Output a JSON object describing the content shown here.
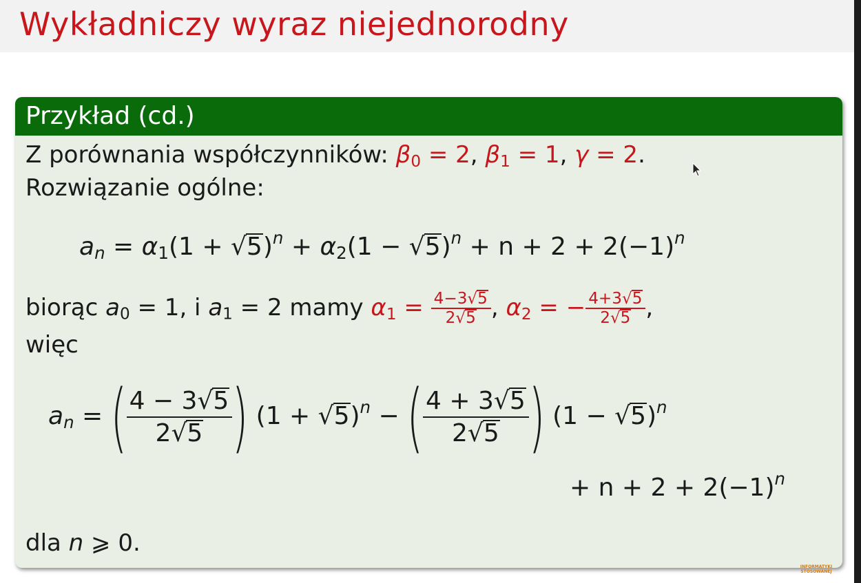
{
  "slide": {
    "title": "Wykładniczy wyraz niejednorodny"
  },
  "block": {
    "title": "Przykład (cd.)",
    "line1_text": "Z porównania współczynników:",
    "beta0": "β",
    "beta0_sub": "0",
    "beta0_val": " = 2",
    "beta1": "β",
    "beta1_sub": "1",
    "beta1_val": " = 1",
    "gamma": "γ",
    "gamma_val": " = 2",
    "line2_text": "Rozwiązanie ogólne:",
    "eq1": {
      "lhs": "a",
      "lhs_sub": "n",
      "alpha1": "α",
      "alpha1_sub": "1",
      "alpha2": "α",
      "alpha2_sub": "2",
      "sup_n": "n",
      "sqrt_arg": "5",
      "tail": " + n + 2 + 2(−1)",
      "tail_sup": "n"
    },
    "line3": {
      "prefix": "biorąc ",
      "a0": "a",
      "a0_sub": "0",
      "a0_val": " = 1, i ",
      "a1": "a",
      "a1_sub": "1",
      "a1_val": " = 2 mamy ",
      "alpha1_num": "4−3",
      "alpha1_den": "2",
      "alpha2_num": "4+3",
      "alpha2_den": "2"
    },
    "line4_text": "więc",
    "eq2": {
      "num1": "4 − 3",
      "num2": "4 + 3",
      "den": "2",
      "tail": "+ n + 2 + 2(−1)"
    },
    "last_line": {
      "prefix": "dla ",
      "var": "n",
      "rest": " ⩾ 0."
    }
  },
  "logo": {
    "line1": "INFORMATYKI",
    "line2": "STOSOWANEJ"
  },
  "colors": {
    "title_red": "#c8161d",
    "block_header_green": "#0a6b0b",
    "block_body": "#e9efe5"
  }
}
